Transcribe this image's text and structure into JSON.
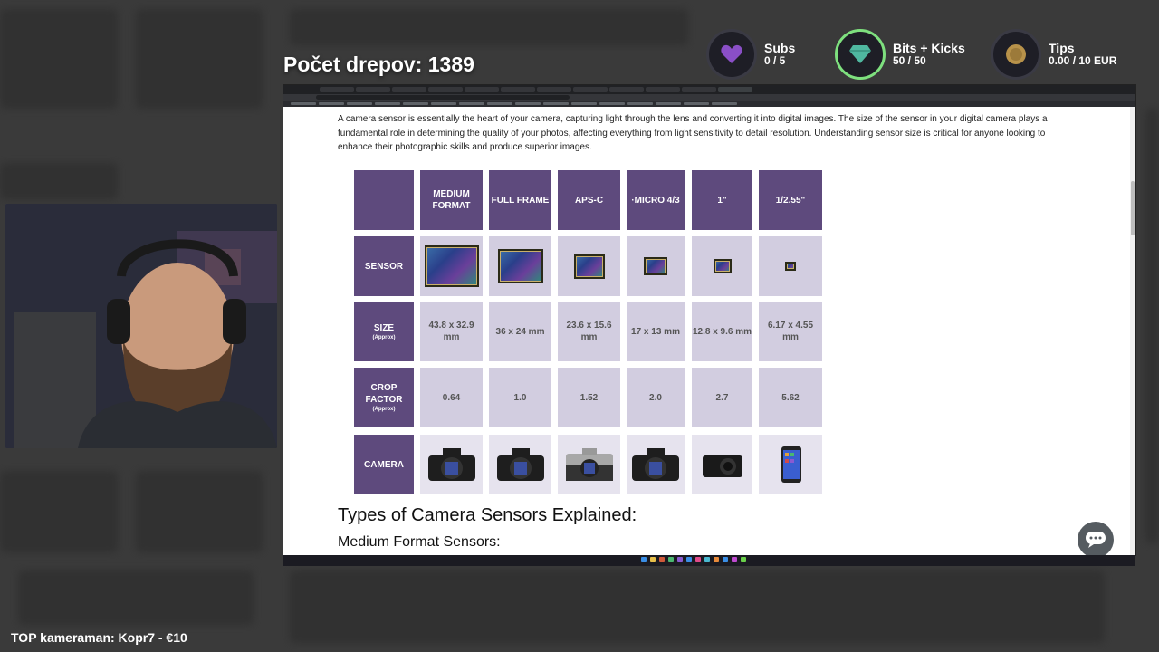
{
  "overlay": {
    "counter_title": "Počet drepov: 1389",
    "goals": [
      {
        "name": "Subs",
        "value": "0 / 5",
        "icon": "heart-icon",
        "ring_color": "#3a3a44"
      },
      {
        "name": "Bits + Kicks",
        "value": "50 / 50",
        "icon": "gem-icon",
        "ring_color": "#7ee07e"
      },
      {
        "name": "Tips",
        "value": "0.00 / 10 EUR",
        "icon": "coin-icon",
        "ring_color": "#3a3a44"
      }
    ],
    "top_cameraman": "TOP kameraman: Kopr7 - €10"
  },
  "page": {
    "intro": "A camera sensor is essentially the heart of your camera, capturing light through the lens and converting it into digital images. The size of the sensor in your digital camera plays a fundamental role in determining the quality of your photos, affecting everything from light sensitivity to detail resolution. Understanding sensor size is critical for anyone looking to enhance their photographic skills and produce superior images.",
    "heading": "Types of Camera Sensors Explained:",
    "subheading": "Medium Format Sensors:"
  },
  "sensor_table": {
    "columns": [
      "MEDIUM FORMAT",
      "FULL FRAME",
      "APS-C",
      "·MICRO 4/3",
      "1\"",
      "1/2.55\""
    ],
    "rows": [
      {
        "label": "SENSOR",
        "sub": ""
      },
      {
        "label": "SIZE",
        "sub": "(Approx)"
      },
      {
        "label": "CROP FACTOR",
        "sub": "(Approx)"
      },
      {
        "label": "CAMERA",
        "sub": ""
      }
    ],
    "sizes": [
      "43.8 x 32.9 mm",
      "36 x 24 mm",
      "23.6 x 15.6 mm",
      "17 x 13 mm",
      "12.8 x 9.6 mm",
      "6.17 x 4.55 mm"
    ],
    "crop_factors": [
      "0.64",
      "1.0",
      "1.52",
      "2.0",
      "2.7",
      "5.62"
    ],
    "sensor_scale": [
      1.0,
      0.82,
      0.54,
      0.39,
      0.29,
      0.14
    ],
    "camera_icons": [
      "medium-format-camera-icon",
      "full-frame-camera-icon",
      "apsc-camera-icon",
      "micro-four-thirds-camera-icon",
      "compact-camera-icon",
      "smartphone-icon"
    ]
  },
  "colors": {
    "table_header": "#5e4a7d",
    "table_cell": "#d2cde0"
  }
}
